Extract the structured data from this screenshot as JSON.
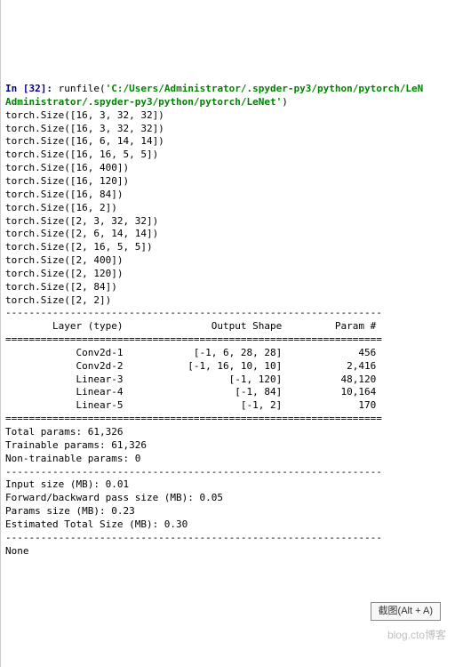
{
  "prompt": {
    "in_label": "In [",
    "n": "32",
    "close": "]:",
    "cmd": "runfile(",
    "path1": "'C:/Users/Administrator/.spyder-py3/python/pytorch/LeN",
    "path2": "Administrator/.spyder-py3/python/pytorch/LeNet'",
    "end": ")"
  },
  "sizes": [
    "torch.Size([16, 3, 32, 32])",
    "torch.Size([16, 3, 32, 32])",
    "torch.Size([16, 6, 14, 14])",
    "torch.Size([16, 16, 5, 5])",
    "torch.Size([16, 400])",
    "torch.Size([16, 120])",
    "torch.Size([16, 84])",
    "torch.Size([16, 2])",
    "torch.Size([2, 3, 32, 32])",
    "torch.Size([2, 6, 14, 14])",
    "torch.Size([2, 16, 5, 5])",
    "torch.Size([2, 400])",
    "torch.Size([2, 120])",
    "torch.Size([2, 84])",
    "torch.Size([2, 2])"
  ],
  "table": {
    "sep_dash": "----------------------------------------------------------------",
    "sep_eq": "================================================================",
    "header": "        Layer (type)               Output Shape         Param #",
    "rows": [
      "            Conv2d-1            [-1, 6, 28, 28]             456",
      "            Conv2d-2           [-1, 16, 10, 10]           2,416",
      "            Linear-3                  [-1, 120]          48,120",
      "            Linear-4                   [-1, 84]          10,164",
      "            Linear-5                    [-1, 2]             170"
    ],
    "totals": [
      "Total params: 61,326",
      "Trainable params: 61,326",
      "Non-trainable params: 0"
    ],
    "mem": [
      "Input size (MB): 0.01",
      "Forward/backward pass size (MB): 0.05",
      "Params size (MB): 0.23",
      "Estimated Total Size (MB): 0.30"
    ]
  },
  "none_line": "None",
  "hint": "截图(Alt + A)",
  "watermark": "blog.cto博客"
}
